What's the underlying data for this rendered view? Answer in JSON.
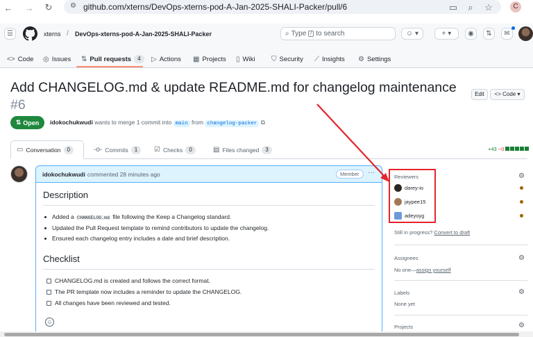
{
  "browser": {
    "url": "github.com/xterns/DevOps-xterns-pod-A-Jan-2025-SHALI-Packer/pull/6",
    "profile_initial": "C"
  },
  "header": {
    "owner": "xterns",
    "separator": "/",
    "repo": "DevOps-xterns-pod-A-Jan-2025-SHALI-Packer",
    "search_placeholder": "Type",
    "search_key": "/",
    "search_suffix": "to search",
    "plus": "+"
  },
  "repo_tabs": [
    {
      "label": "Code",
      "icon": "code-icon"
    },
    {
      "label": "Issues",
      "icon": "issue-icon"
    },
    {
      "label": "Pull requests",
      "icon": "pull-request-icon",
      "count": "4"
    },
    {
      "label": "Actions",
      "icon": "play-icon"
    },
    {
      "label": "Projects",
      "icon": "table-icon"
    },
    {
      "label": "Wiki",
      "icon": "book-icon"
    },
    {
      "label": "Security",
      "icon": "shield-icon"
    },
    {
      "label": "Insights",
      "icon": "graph-icon"
    },
    {
      "label": "Settings",
      "icon": "gear-icon"
    }
  ],
  "pr": {
    "title": "Add CHANGELOG.md & update README.md for changelog maintenance",
    "number": "#6",
    "edit_label": "Edit",
    "code_label": "Code",
    "state": "Open",
    "author": "idokochukwudi",
    "merge_text": "wants to merge 1 commit into",
    "base_branch": "main",
    "from_text": "from",
    "head_branch": "changelog-packer",
    "diff_add": "+43",
    "diff_del": "−0"
  },
  "pr_tabs": [
    {
      "label": "Conversation",
      "count": "0"
    },
    {
      "label": "Commits",
      "count": "1"
    },
    {
      "label": "Checks",
      "count": "0"
    },
    {
      "label": "Files changed",
      "count": "3"
    }
  ],
  "comment": {
    "author": "idokochukwudi",
    "time": "commented 28 minutes ago",
    "badge": "Member",
    "menu": "···",
    "description_heading": "Description",
    "bullets": [
      {
        "before": "Added a",
        "code": "CHANGELOG.md",
        "after": "file following the Keep a Changelog standard."
      },
      {
        "before": "Updated the Pull Request template to remind contributors to update the changelog.",
        "code": "",
        "after": ""
      },
      {
        "before": "Ensured each changelog entry includes a date and brief description.",
        "code": "",
        "after": ""
      }
    ],
    "checklist_heading": "Checklist",
    "checklist": [
      "CHANGELOG.md is created and follows the correct format.",
      "The PR template now includes a reminder to update the CHANGELOG.",
      "All changes have been reviewed and tested."
    ]
  },
  "sidebar": {
    "reviewers_heading": "Reviewers",
    "reviewers": [
      "darey-io",
      "jaypee15",
      "adeyoyg"
    ],
    "draft_prefix": "Still in progress?",
    "draft_link": "Convert to draft",
    "assignees_heading": "Assignees",
    "assignees_none": "No one—",
    "assign_link": "assign yourself",
    "labels_heading": "Labels",
    "labels_none": "None yet",
    "projects_heading": "Projects"
  },
  "colors": {
    "open_green": "#1f883d",
    "link_blue": "#0969da",
    "annotation_red": "#e5242a",
    "tab_underline": "#fd8c73",
    "pending_dot": "#9a6700"
  }
}
